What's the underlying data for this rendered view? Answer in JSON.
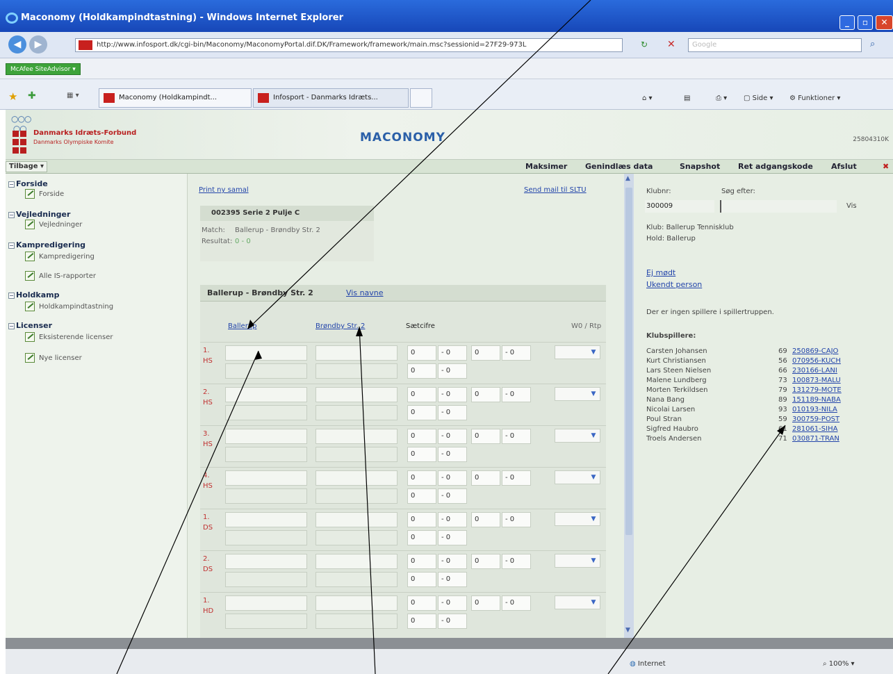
{
  "window": {
    "title": "Maconomy (Holdkampindtastning) - Windows Internet Explorer"
  },
  "browser": {
    "url": "http://www.infosport.dk/cgi-bin/Maconomy/MaconomyPortal.dif.DK/Framework/framework/main.msc?sessionid=27F29-973L",
    "search_placeholder": "Google",
    "mcafee_label": "McAfee SiteAdvisor",
    "tabs": [
      "Maconomy (Holdkampindt...",
      "Infosport - Danmarks Idræts..."
    ],
    "tools": [
      "Side",
      "Funktioner"
    ]
  },
  "banner": {
    "org_line1": "Danmarks Idræts-Forbund",
    "org_line2": "Danmarks Olympiske Komite",
    "brand": "MACONOMY",
    "session_id": "25804310K"
  },
  "menubar": {
    "back": "Tilbage",
    "items": [
      "Maksimer",
      "Genindlæs data",
      "Snapshot",
      "Ret adgangskode",
      "Afslut"
    ]
  },
  "nav": {
    "sections": [
      {
        "title": "Forside",
        "items": [
          "Forside"
        ]
      },
      {
        "title": "Vejledninger",
        "items": [
          "Vejledninger"
        ]
      },
      {
        "title": "Kampredigering",
        "items": [
          "Kampredigering",
          "Alle IS-rapporter"
        ]
      },
      {
        "title": "Holdkamp",
        "items": [
          "Holdkampindtastning"
        ]
      },
      {
        "title": "Licenser",
        "items": [
          "Eksisterende licenser",
          "Nye licenser"
        ]
      }
    ]
  },
  "main": {
    "print_link": "Print ny samal",
    "mail_link": "Send mail til SLTU",
    "info_header": "002395 Serie 2 Pulje C",
    "match_label": "Match:",
    "match_value": "Ballerup - Brøndby Str. 2",
    "result_label": "Resultat:",
    "result_value": "0 - 0",
    "team_header": "Ballerup - Brøndby Str. 2",
    "show_names": "Vis navne",
    "col_home": "Ballerup",
    "col_away": "Brøndby Str. 2",
    "col_sets": "Sætcifre",
    "col_wo": "W0 / Rtp",
    "rows": [
      {
        "label": "1. HS"
      },
      {
        "label": "2. HS"
      },
      {
        "label": "3. HS"
      },
      {
        "label": "4. HS"
      },
      {
        "label": "1. DS"
      },
      {
        "label": "2. DS"
      },
      {
        "label": "1. HD"
      }
    ],
    "set_zero": "0",
    "set_sep": "- 0"
  },
  "right": {
    "club_label": "Klubnr:",
    "search_label": "Søg efter:",
    "club_value": "300009",
    "show_btn": "Vis",
    "club_line": "Klub: Ballerup Tennisklub",
    "team_line": "Hold: Ballerup",
    "no_show": "Ej mødt",
    "unknown": "Ukendt person",
    "empty_msg": "Der er ingen spillere i spillertruppen.",
    "players_header": "Klubspillere:",
    "players": [
      {
        "name": "Carsten Johansen",
        "age": "69",
        "code": "250869-CAJO"
      },
      {
        "name": "Kurt Christiansen",
        "age": "56",
        "code": "070956-KUCH"
      },
      {
        "name": "Lars Steen Nielsen",
        "age": "66",
        "code": "230166-LANI"
      },
      {
        "name": "Malene Lundberg",
        "age": "73",
        "code": "100873-MALU"
      },
      {
        "name": "Morten Terkildsen",
        "age": "79",
        "code": "131279-MOTE"
      },
      {
        "name": "Nana Bang",
        "age": "89",
        "code": "151189-NABA"
      },
      {
        "name": "Nicolai Larsen",
        "age": "93",
        "code": "010193-NILA"
      },
      {
        "name": "Poul Stran",
        "age": "59",
        "code": "300759-POST"
      },
      {
        "name": "Sigfred Haubro",
        "age": "61",
        "code": "281061-SIHA"
      },
      {
        "name": "Troels Andersen",
        "age": "71",
        "code": "030871-TRAN"
      }
    ]
  },
  "statusbar": {
    "zone": "Internet",
    "zoom": "100%"
  }
}
